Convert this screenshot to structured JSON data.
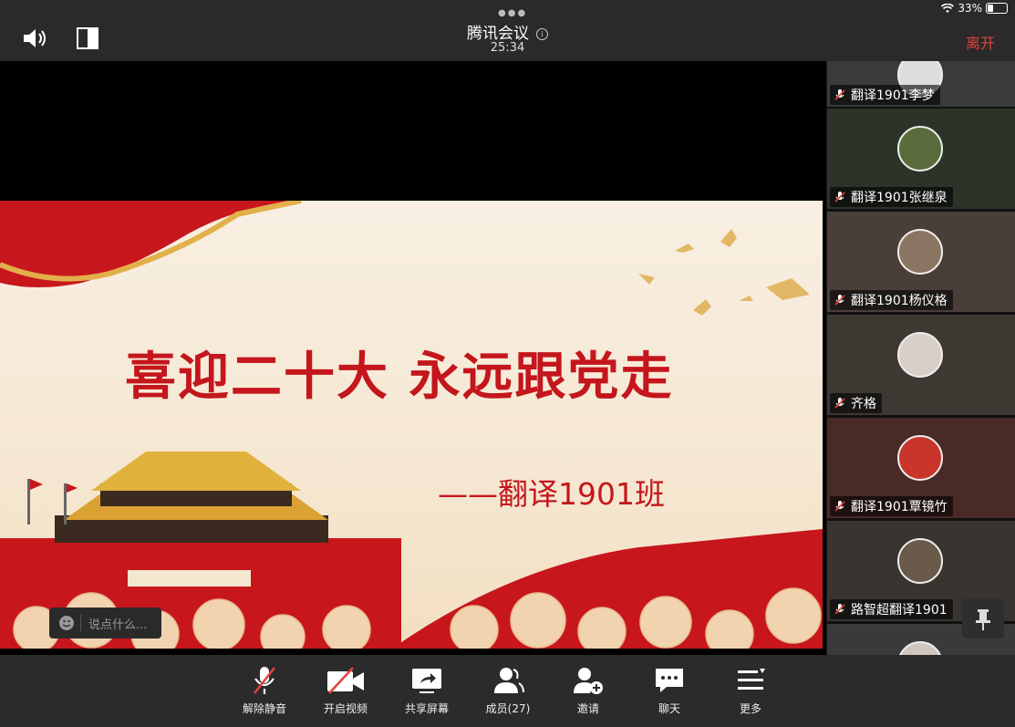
{
  "status": {
    "battery": "33%"
  },
  "header": {
    "title": "腾讯会议",
    "timer": "25:34",
    "leave": "离开"
  },
  "slide": {
    "heading": "喜迎二十大 永远跟党走",
    "subtitle": "——翻译1901班"
  },
  "chat": {
    "placeholder": "说点什么..."
  },
  "participants": [
    {
      "name": "翻译1901李梦"
    },
    {
      "name": "翻译1901张继泉"
    },
    {
      "name": "翻译1901杨仪格"
    },
    {
      "name": "齐格"
    },
    {
      "name": "翻译1901覃镜竹"
    },
    {
      "name": "路智超翻译1901"
    }
  ],
  "toolbar": {
    "unmute": "解除静音",
    "video": "开启视频",
    "share": "共享屏幕",
    "members": "成员(27)",
    "invite": "邀请",
    "chat": "聊天",
    "more": "更多"
  },
  "colors": {
    "accent_red": "#e0433a",
    "slide_red": "#c4161c"
  }
}
